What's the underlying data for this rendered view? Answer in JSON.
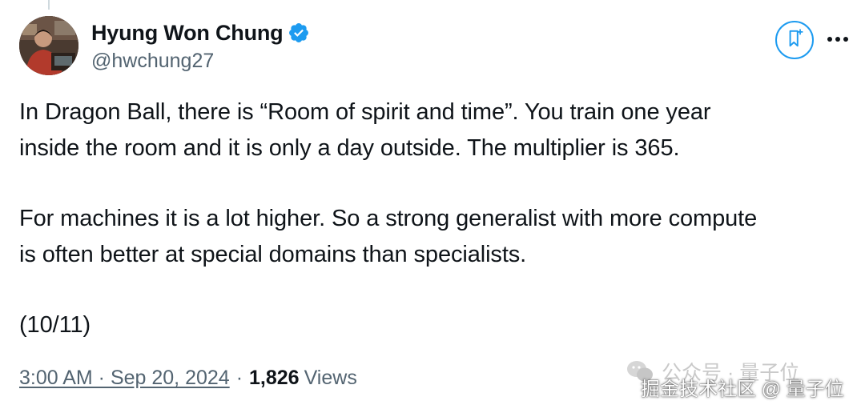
{
  "author": {
    "display_name": "Hyung Won Chung",
    "handle": "@hwchung27",
    "verified": true
  },
  "icons": {
    "avatar": "avatar-photo",
    "verified": "verified-badge-icon",
    "grok": "grok-bookmark-icon",
    "more": "more-horizontal-icon"
  },
  "tweet": {
    "paragraphs": [
      "In Dragon Ball, there is “Room of spirit and time”. You train one year\ninside the room and it is only a day outside. The multiplier is 365.",
      "For machines it is a lot higher. So a strong generalist with more compute\nis often better at special domains than specialists.",
      "(10/11)"
    ]
  },
  "meta": {
    "timestamp": "3:00 AM · Sep 20, 2024",
    "separator": "·",
    "views_count": "1,826",
    "views_label": "Views"
  },
  "watermark": {
    "top": "公众号 · 量子位",
    "bottom": "掘金技术社区 @ 量子位"
  },
  "colors": {
    "text": "#0f1419",
    "secondary": "#536471",
    "accent": "#1d9bf0",
    "verified": "#1d9bf0"
  }
}
